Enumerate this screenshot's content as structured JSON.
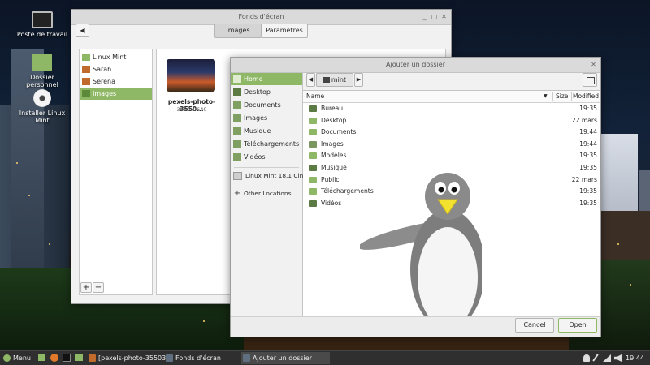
{
  "desktop": {
    "icons": [
      {
        "label": "Poste de travail",
        "icon": "computer-icon"
      },
      {
        "label": "Dossier personnel",
        "icon": "home-folder-icon"
      },
      {
        "label": "Installer Linux Mint",
        "icon": "disc-icon"
      }
    ]
  },
  "backgrounds_window": {
    "title": "Fonds d'écran",
    "tabs": [
      "Images",
      "Paramètres"
    ],
    "active_tab": "Images",
    "sources": [
      "Linux Mint",
      "Sarah",
      "Serena",
      "Images"
    ],
    "selected_source": "Images",
    "add_label": "+",
    "remove_label": "−",
    "thumbnail": {
      "name": "pexels-photo-3550...",
      "size": "3960x2640"
    }
  },
  "dialog": {
    "title": "Ajouter un dossier",
    "path_button": "mint",
    "places": [
      {
        "label": "Home",
        "icon": "home-icon"
      },
      {
        "label": "Desktop",
        "icon": "desktop-folder-icon"
      },
      {
        "label": "Documents",
        "icon": "documents-folder-icon"
      },
      {
        "label": "Images",
        "icon": "pictures-folder-icon"
      },
      {
        "label": "Musique",
        "icon": "music-folder-icon"
      },
      {
        "label": "Téléchargements",
        "icon": "downloads-folder-icon"
      },
      {
        "label": "Vidéos",
        "icon": "videos-folder-icon"
      }
    ],
    "selected_place": "Home",
    "device": "Linux Mint 18.1 Cin...",
    "other_locations": "Other Locations",
    "columns": {
      "name": "Name",
      "size": "Size",
      "modified": "Modified"
    },
    "files": [
      {
        "name": "Bureau",
        "modified": "19:35"
      },
      {
        "name": "Desktop",
        "modified": "22 mars"
      },
      {
        "name": "Documents",
        "modified": "19:44"
      },
      {
        "name": "Images",
        "modified": "19:44"
      },
      {
        "name": "Modèles",
        "modified": "19:35"
      },
      {
        "name": "Musique",
        "modified": "19:35"
      },
      {
        "name": "Public",
        "modified": "22 mars"
      },
      {
        "name": "Téléchargements",
        "modified": "19:35"
      },
      {
        "name": "Vidéos",
        "modified": "19:35"
      }
    ],
    "cancel_label": "Cancel",
    "open_label": "Open"
  },
  "taskbar": {
    "menu_label": "Menu",
    "tasks": [
      "[pexels-photo-35503...",
      "Fonds d'écran",
      "Ajouter un dossier"
    ],
    "clock": "19:44"
  },
  "colors": {
    "accent": "#8fb866",
    "panel": "#2f2f2f",
    "window_bg": "#f1f1f1"
  }
}
